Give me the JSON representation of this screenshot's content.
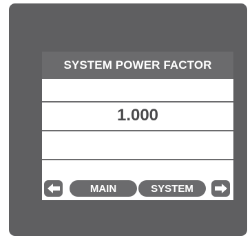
{
  "panel": {
    "title": "SYSTEM POWER FACTOR",
    "reading": "1.000"
  },
  "nav": {
    "prev_icon": "arrow-left-icon",
    "main_label": "MAIN",
    "system_label": "SYSTEM",
    "next_icon": "arrow-right-icon"
  },
  "colors": {
    "bezel": "#5f5f61",
    "bar": "#6b6b6d",
    "screen": "#ffffff",
    "value_text": "#4a4a4c"
  }
}
